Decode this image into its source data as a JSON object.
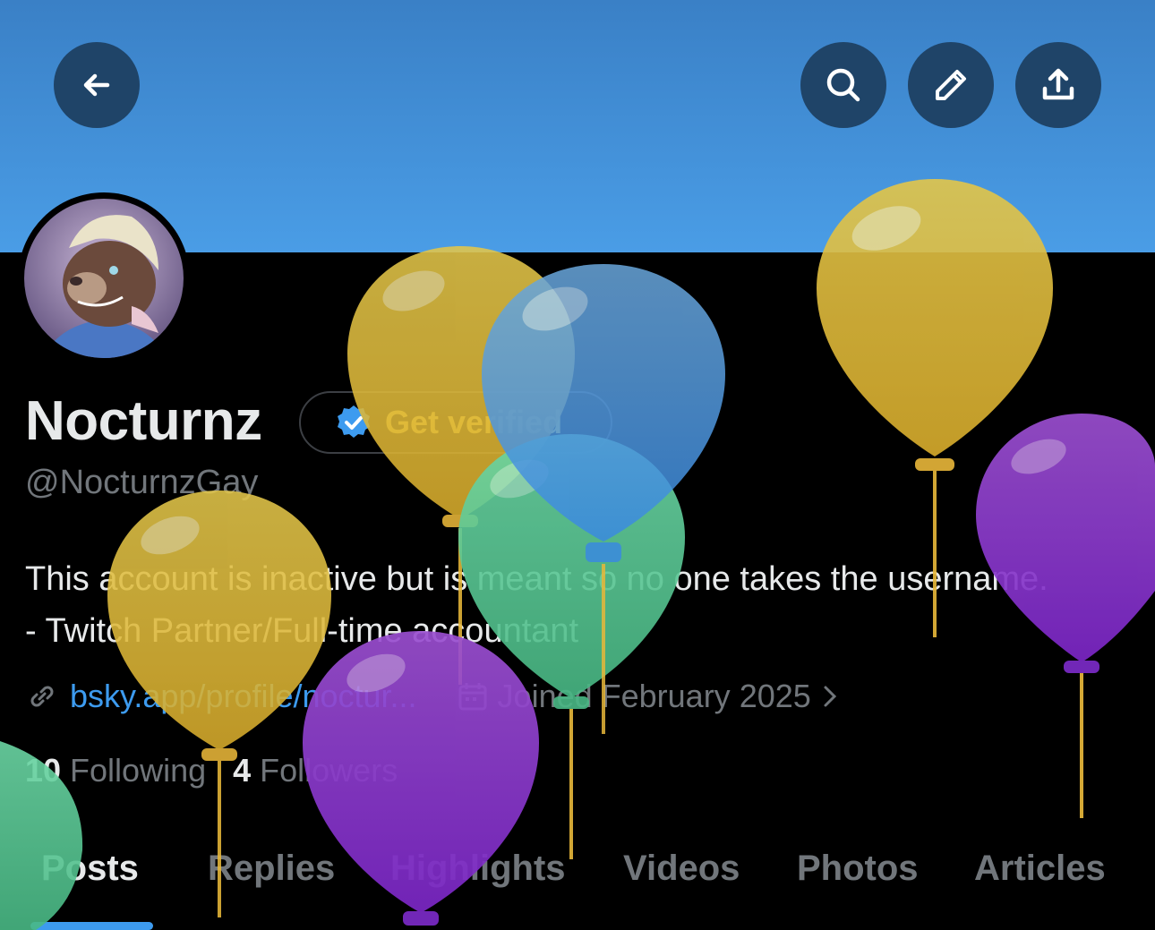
{
  "header": {
    "back_icon": "arrow-left-icon",
    "search_icon": "search-icon",
    "edit_icon": "pencil-icon",
    "share_icon": "share-upload-icon",
    "banner_color": "#4a9de6"
  },
  "profile": {
    "name": "Nocturnz",
    "verify_label": "Get verified",
    "handle": "@NocturnzGay",
    "bio": "This account is inactive but is meant so no one takes the username. - Twitch Partner/Full-time accountant",
    "link": "bsky.app/profile/noctur...",
    "joined": "Joined February 2025",
    "following_count": "10",
    "following_label": "Following",
    "followers_count": "4",
    "followers_label": "Followers"
  },
  "tabs": [
    "Posts",
    "Replies",
    "Highlights",
    "Videos",
    "Photos",
    "Articles"
  ],
  "colors": {
    "accent": "#3d9bef",
    "verify_text": "#efd34c",
    "muted": "#71767b"
  }
}
